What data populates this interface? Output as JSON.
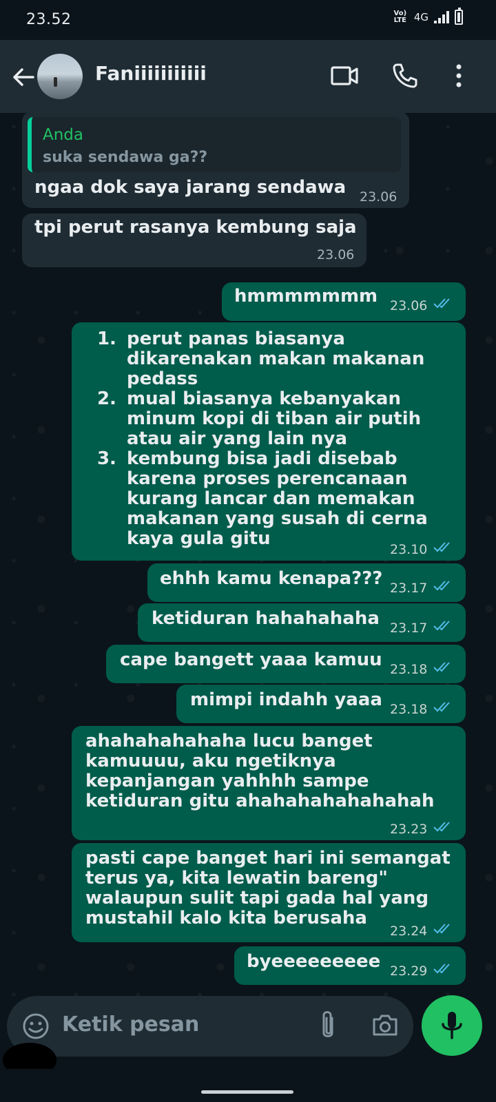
{
  "status_bar": {
    "time": "23.52",
    "network_type": "4G",
    "volte_label": "Vo) LTE"
  },
  "header": {
    "contact_name": "Faniiiiiiiiiii"
  },
  "colors": {
    "accent_green": "#21c063",
    "outgoing_bubble": "#005c4b",
    "incoming_bubble": "#1f2c34",
    "tick_blue": "#53bdeb"
  },
  "messages": [
    {
      "direction": "in",
      "reply_to": {
        "author": "Anda",
        "text": "suka sendawa ga??"
      },
      "text": "ngaa dok saya jarang sendawa",
      "time": "23.06"
    },
    {
      "direction": "in",
      "text": "tpi perut rasanya kembung saja",
      "time": "23.06"
    },
    {
      "direction": "out",
      "text": "hmmmmmmm",
      "time": "23.06",
      "status": "read"
    },
    {
      "direction": "out",
      "list": [
        "perut panas biasanya dikarenakan makan makanan pedass",
        "mual biasanya kebanyakan minum kopi di tiban air putih atau air yang lain nya",
        "kembung bisa jadi disebab karena proses perencanaan kurang lancar dan memakan makanan yang susah di cerna kaya gula gitu"
      ],
      "time": "23.10",
      "status": "read"
    },
    {
      "direction": "out",
      "text": "ehhh kamu kenapa???",
      "time": "23.17",
      "status": "read"
    },
    {
      "direction": "out",
      "text": "ketiduran hahahahaha",
      "time": "23.17",
      "status": "read"
    },
    {
      "direction": "out",
      "text": "cape bangett yaaa kamuu",
      "time": "23.18",
      "status": "read"
    },
    {
      "direction": "out",
      "text": "mimpi indahh yaaa",
      "time": "23.18",
      "status": "read"
    },
    {
      "direction": "out",
      "text": "ahahahahahaha lucu banget kamuuuu, aku ngetiknya kepanjangan yahhhh sampe ketiduran gitu ahahahahahahahah",
      "time": "23.23",
      "status": "read"
    },
    {
      "direction": "out",
      "text": "pasti cape banget hari ini semangat terus ya, kita lewatin bareng\" walaupun sulit tapi gada hal yang mustahil kalo kita berusaha",
      "time": "23.24",
      "status": "read"
    },
    {
      "direction": "out",
      "text": "byeeeeeeeee",
      "time": "23.29",
      "status": "read"
    }
  ],
  "composer": {
    "placeholder": "Ketik pesan"
  }
}
